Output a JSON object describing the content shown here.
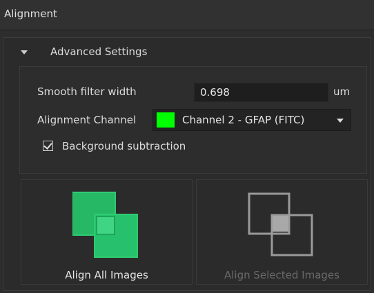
{
  "panel": {
    "title": "Alignment"
  },
  "advanced": {
    "title": "Advanced Settings",
    "smooth_filter": {
      "label": "Smooth filter width",
      "value": "0.698",
      "unit": "um"
    },
    "alignment_channel": {
      "label": "Alignment Channel",
      "selected": "Channel 2 - GFAP (FITC)",
      "swatch_color": "#00ff00"
    },
    "background_subtraction": {
      "label": "Background subtraction",
      "checked": true
    }
  },
  "buttons": {
    "align_all": {
      "label": "Align All Images",
      "icon": "align-images-icon",
      "color": "#2ecc71"
    },
    "align_selected": {
      "label": "Align Selected Images",
      "icon": "align-selected-images-icon",
      "enabled": false
    }
  }
}
